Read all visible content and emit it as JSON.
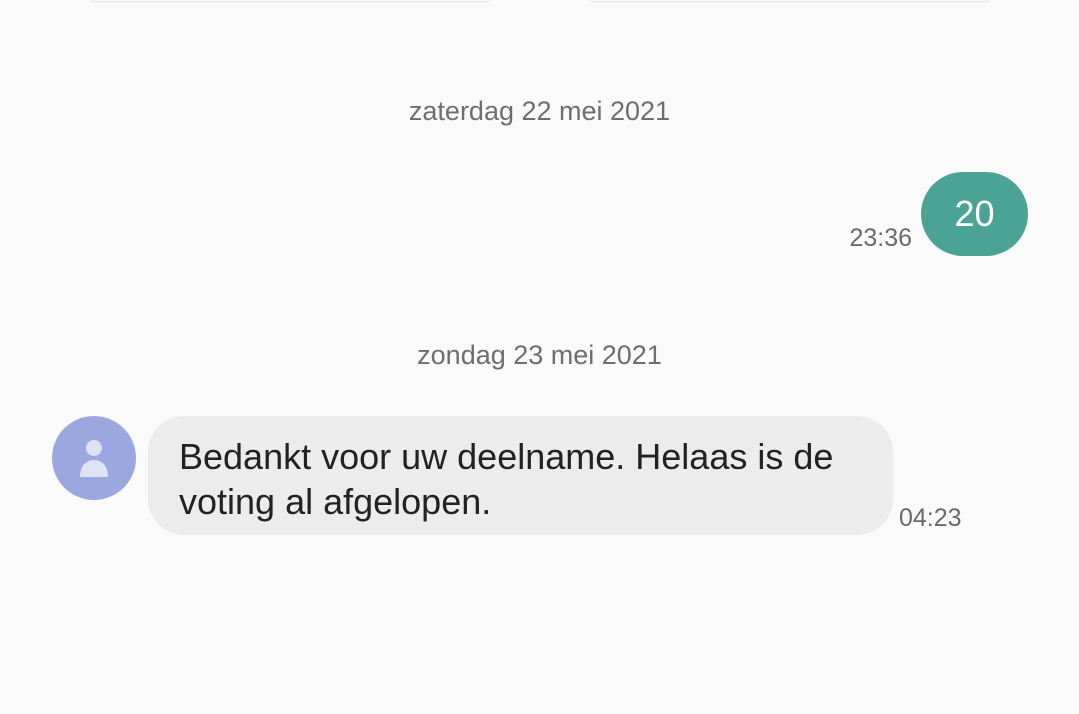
{
  "conversation": {
    "date_1": "zaterdag 22 mei 2021",
    "date_2": "zondag 23 mei 2021",
    "messages": [
      {
        "direction": "sent",
        "text": "20",
        "time": "23:36"
      },
      {
        "direction": "received",
        "text": "Bedankt voor uw deelname. Helaas is de voting al afgelopen.",
        "time": "04:23"
      }
    ]
  },
  "icons": {
    "avatar": "contact-avatar-icon"
  },
  "colors": {
    "background": "#fafafa",
    "sent_bubble": "#4aa394",
    "received_bubble": "#ececec",
    "avatar": "#9aa8df",
    "date_text": "#6e6e6e",
    "time_text": "#6a6a6a"
  }
}
